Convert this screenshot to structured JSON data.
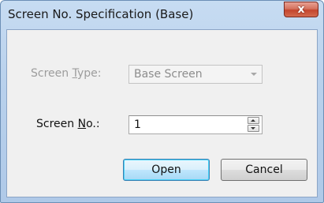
{
  "window": {
    "title": "Screen No. Specification (Base)",
    "close_glyph": "x"
  },
  "screen_type": {
    "label_prefix": "Screen ",
    "label_mnemonic": "T",
    "label_suffix": "ype:",
    "value": "Base Screen",
    "enabled": false
  },
  "screen_no": {
    "label_prefix": "Screen ",
    "label_mnemonic": "N",
    "label_suffix": "o.:",
    "value": "1"
  },
  "buttons": {
    "open": "Open",
    "cancel": "Cancel"
  },
  "colors": {
    "title_bar": "#b9d1ec",
    "close_button": "#c4452d",
    "dialog_face": "#f0f0f0",
    "default_button_border": "#3c7fb1"
  },
  "icons": {
    "close": "close-icon",
    "dropdown": "chevron-down-icon",
    "spin_up": "spin-up-icon",
    "spin_down": "spin-down-icon"
  }
}
